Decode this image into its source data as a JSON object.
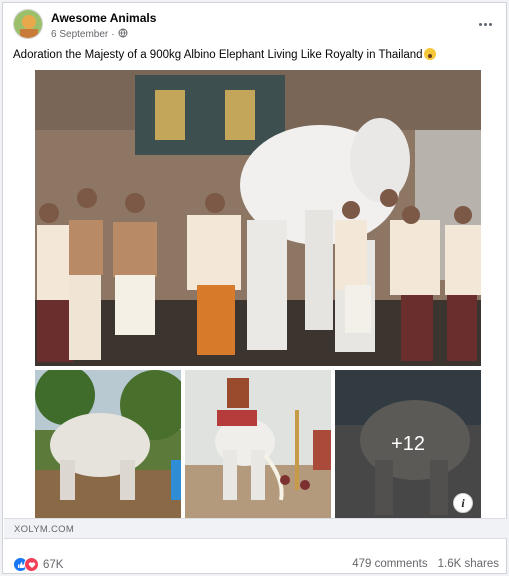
{
  "post": {
    "page_name": "Awesome Animals",
    "date": "6 September",
    "date_separator": "·",
    "caption": "Adoration the Majesty of a 900kg Albino Elephant Living Like Royalty in Thailand",
    "caption_emoji": "astonished-face-emoji"
  },
  "media": {
    "more_count": "+12",
    "info_label": "i"
  },
  "link": {
    "source": "XOLYM.COM"
  },
  "engagement": {
    "reaction_icons": [
      "like-icon",
      "love-icon"
    ],
    "reaction_count": "67K",
    "comments": "479 comments",
    "shares": "1.6K shares"
  },
  "colors": {
    "like": "#1877f2",
    "love": "#f33e58",
    "secondary_text": "#65676b"
  }
}
